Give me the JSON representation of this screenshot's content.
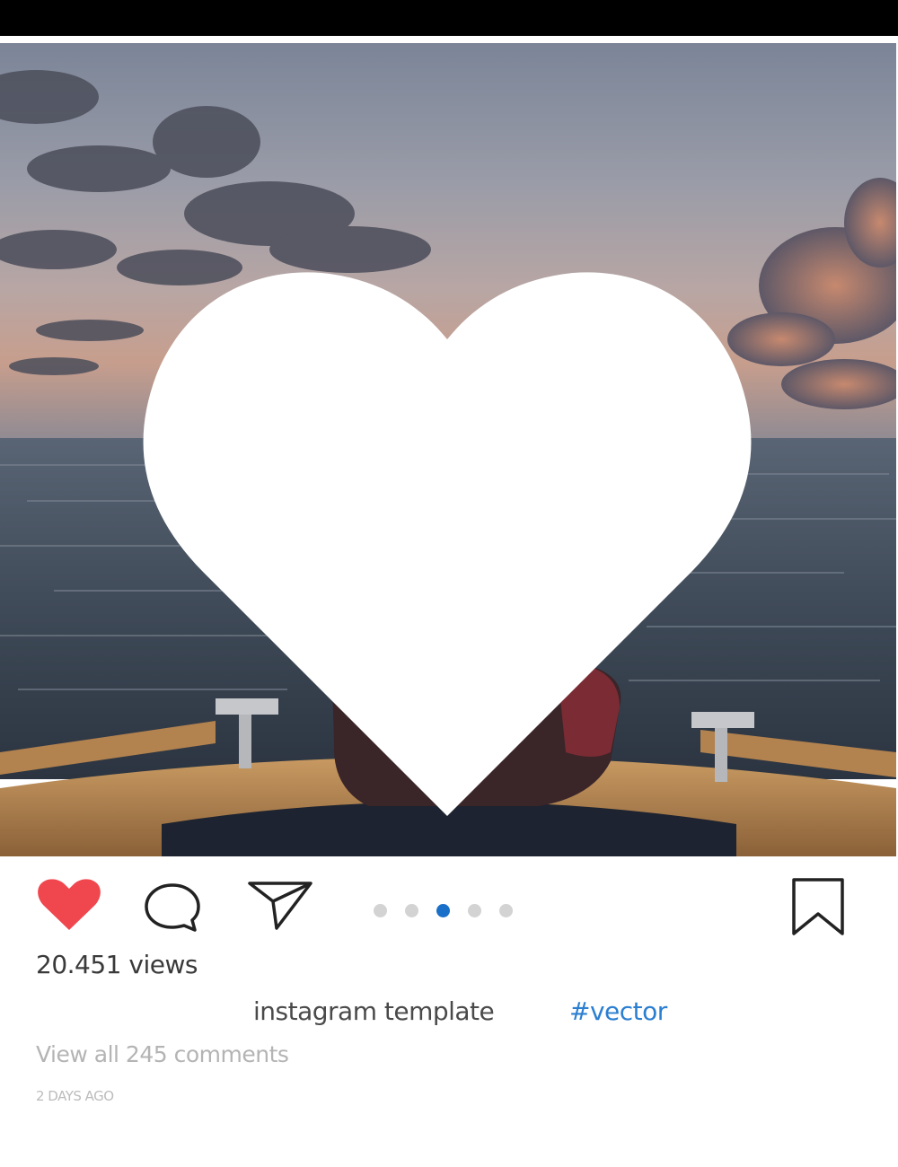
{
  "post": {
    "image_alt": "sunset over sea from boat bow",
    "views_label": "20.451 views",
    "caption": "instagram template",
    "hashtag": "#vector",
    "comments_link": "View all 245 comments",
    "timestamp": "2 DAYS AGO"
  },
  "actions": {
    "like_icon": "heart-filled-icon",
    "comment_icon": "speech-bubble-icon",
    "share_icon": "paper-plane-icon",
    "save_icon": "bookmark-icon",
    "liked": true
  },
  "carousel": {
    "total": 5,
    "active_index": 2
  },
  "colors": {
    "like": "#f0474f",
    "active_dot": "#1a6fc9",
    "hashtag": "#2b7fd1"
  }
}
